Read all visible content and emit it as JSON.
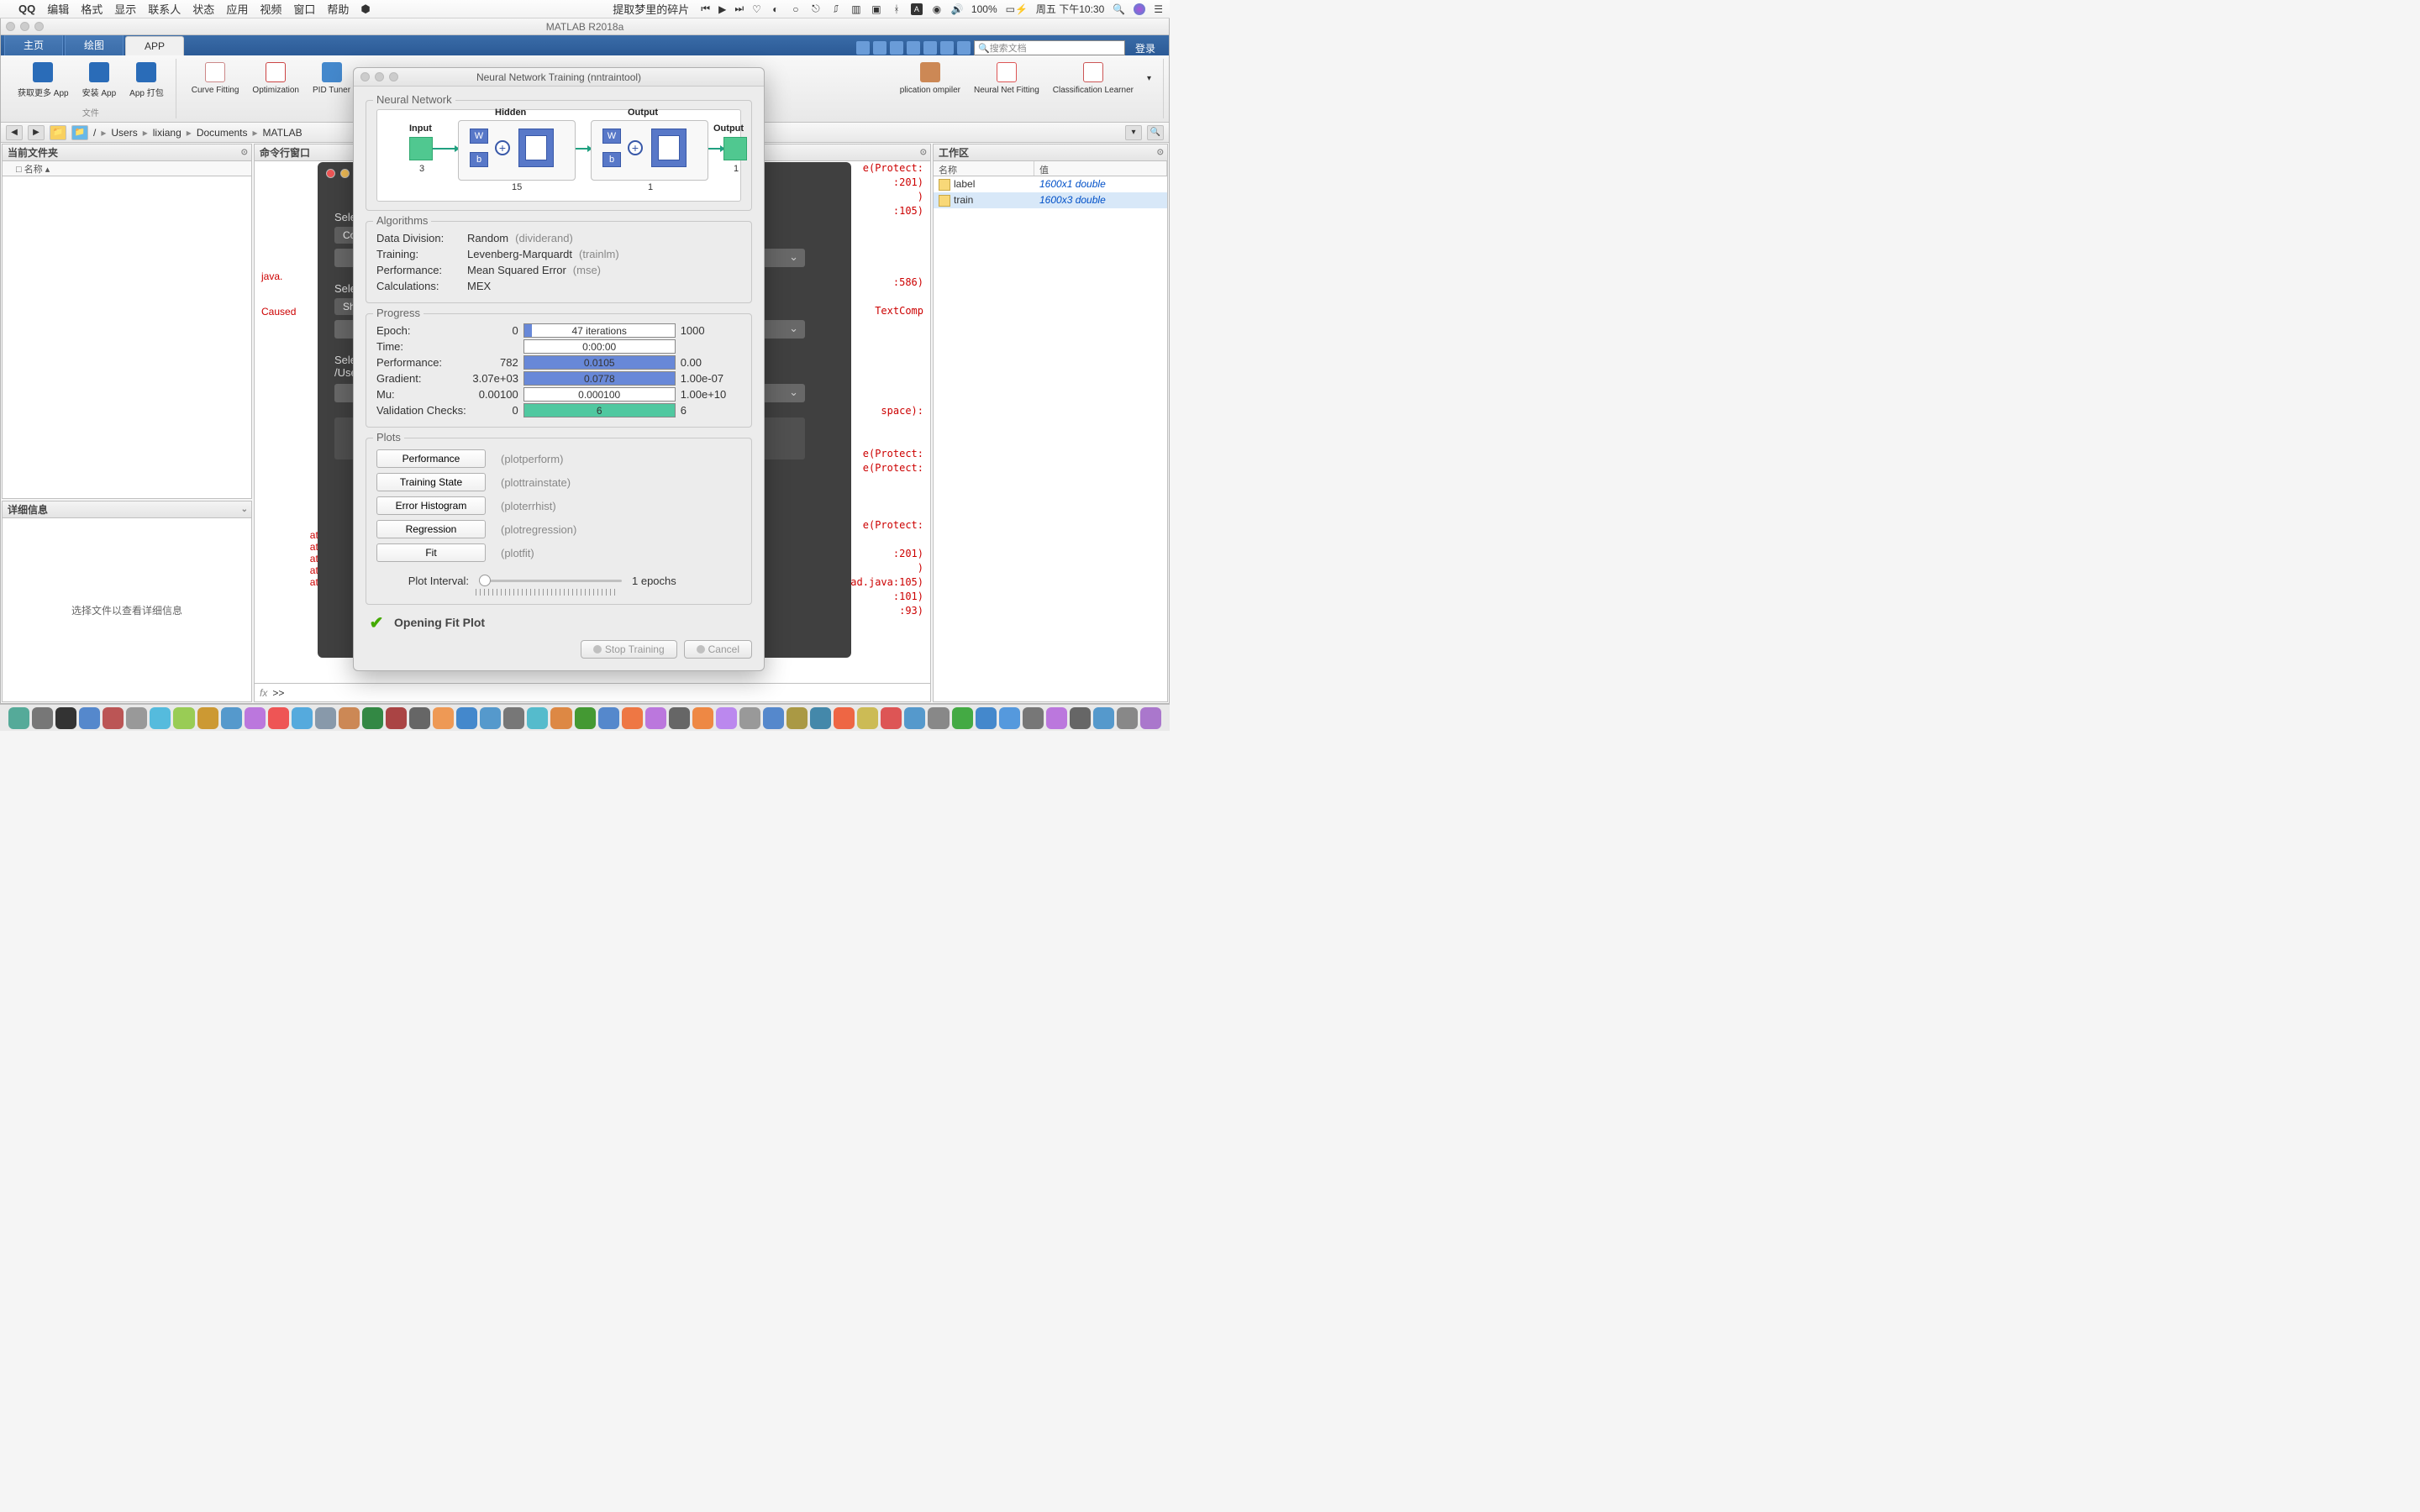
{
  "menubar": {
    "app": "QQ",
    "items": [
      "编辑",
      "格式",
      "显示",
      "联系人",
      "状态",
      "应用",
      "视频",
      "窗口",
      "帮助"
    ],
    "nowplaying": "提取梦里的碎片",
    "battery": "100%",
    "clock": "周五 下午10:30"
  },
  "matlab": {
    "title": "MATLAB R2018a",
    "tabs": {
      "home": "主页",
      "plot": "绘图",
      "app": "APP"
    },
    "search_placeholder": "搜索文档",
    "login": "登录",
    "toolstrip": {
      "get_more": "获取更多 App",
      "install": "安装\nApp",
      "package": "App\n打包",
      "file_label": "文件",
      "curve_fitting": "Curve Fitting",
      "optimization": "Optimization",
      "pid_tuner": "PID Tuner",
      "app_compiler": "plication\nompiler",
      "nn_fitting": "Neural Net\nFitting",
      "classification": "Classification\nLearner"
    },
    "breadcrumbs": [
      "/",
      "Users",
      "lixiang",
      "Documents",
      "MATLAB"
    ]
  },
  "panels": {
    "current_folder": "当前文件夹",
    "name_col": "名称",
    "details": "详细信息",
    "details_hint": "选择文件以查看详细信息",
    "command_window": "命令行窗口",
    "workspace": "工作区",
    "ws_cols": {
      "name": "名称",
      "value": "值"
    },
    "ws_rows": [
      {
        "name": "label",
        "value": "1600x1 double"
      },
      {
        "name": "train",
        "value": "1600x3 double"
      }
    ]
  },
  "cmd": {
    "lines_left": "\n\n\n\n\n\n\n\n\njava.\n\n\nCaused\n\n\n\n\n\n\n\n\n\n\n\n\n\n\n\n\n\n\n\tat\n\tat\n\tat\n\tat\n\tat",
    "lines_right": "e(Protect:\n:201)\n)\n:105)\n\n\n\n\n:586)\n\nTextComp\n\n\n\n\n\n\n space):\n\n\ne(Protect:\ne(Protect:\n\n\n\ne(Protect:\n\n:201)\n)\nhThread.java:105)\n:101)\n:93)",
    "prompt": ">>"
  },
  "darkpanel": {
    "sel1": "Sele",
    "btn1": "Co",
    "sel2": "Sele",
    "btn2": "Sh",
    "sel3": "Sele",
    "path": "/Use"
  },
  "modal": {
    "title": "Neural Network Training (nntraintool)",
    "groups": {
      "network": "Neural Network",
      "algorithms": "Algorithms",
      "progress": "Progress",
      "plots": "Plots"
    },
    "net": {
      "input": "Input",
      "hidden": "Hidden",
      "output": "Output",
      "output2": "Output",
      "in_size": "3",
      "hidden_size": "15",
      "out_size": "1",
      "out2_size": "1",
      "w": "W",
      "b": "b"
    },
    "algo": {
      "data_div_l": "Data Division:",
      "data_div_v": "Random",
      "data_div_f": "(dividerand)",
      "training_l": "Training:",
      "training_v": "Levenberg-Marquardt",
      "training_f": "(trainlm)",
      "perf_l": "Performance:",
      "perf_v": "Mean Squared Error",
      "perf_f": "(mse)",
      "calc_l": "Calculations:",
      "calc_v": "MEX"
    },
    "progress": {
      "epoch": {
        "l": "Epoch:",
        "s": "0",
        "t": "47 iterations",
        "e": "1000",
        "fill": 4
      },
      "time": {
        "l": "Time:",
        "s": "",
        "t": "0:00:00",
        "e": "",
        "fill": 0
      },
      "perf": {
        "l": "Performance:",
        "s": "782",
        "t": "0.0105",
        "e": "0.00",
        "fill": 100
      },
      "grad": {
        "l": "Gradient:",
        "s": "3.07e+03",
        "t": "0.0778",
        "e": "1.00e-07",
        "fill": 100
      },
      "mu": {
        "l": "Mu:",
        "s": "0.00100",
        "t": "0.000100",
        "e": "1.00e+10",
        "fill": 0
      },
      "val": {
        "l": "Validation Checks:",
        "s": "0",
        "t": "6",
        "e": "6",
        "fill": 100
      }
    },
    "plots": {
      "perf": {
        "b": "Performance",
        "f": "(plotperform)"
      },
      "state": {
        "b": "Training State",
        "f": "(plottrainstate)"
      },
      "err": {
        "b": "Error Histogram",
        "f": "(ploterrhist)"
      },
      "reg": {
        "b": "Regression",
        "f": "(plotregression)"
      },
      "fit": {
        "b": "Fit",
        "f": "(plotfit)"
      },
      "interval_l": "Plot Interval:",
      "interval_v": "1 epochs"
    },
    "status": "Opening Fit Plot",
    "btn_stop": "Stop Training",
    "btn_cancel": "Cancel"
  },
  "dock_colors": [
    "#5a9",
    "#777",
    "#333",
    "#58c",
    "#b55",
    "#999",
    "#5bd",
    "#9c5",
    "#c93",
    "#59c",
    "#b7d",
    "#e55",
    "#5ad",
    "#89a",
    "#c85",
    "#384",
    "#a44",
    "#666",
    "#e95",
    "#48c",
    "#59c",
    "#777",
    "#5bc",
    "#d84",
    "#493",
    "#58c",
    "#e74",
    "#b7d",
    "#666",
    "#e84",
    "#b8e",
    "#999",
    "#58c",
    "#a94",
    "#48a",
    "#e64",
    "#cb5",
    "#d55",
    "#59c",
    "#888",
    "#4a4",
    "#48c",
    "#59d",
    "#777",
    "#b7d",
    "#666",
    "#59c",
    "#888",
    "#a7c"
  ]
}
